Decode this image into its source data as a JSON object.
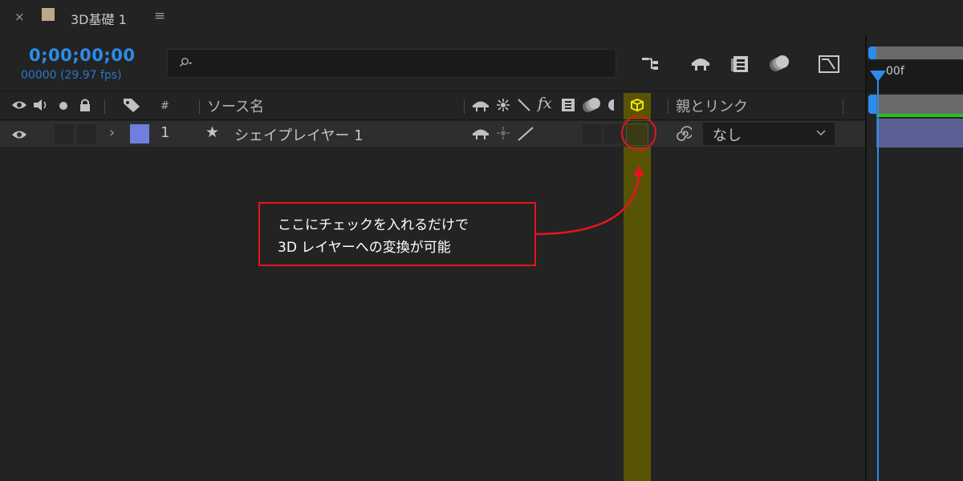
{
  "tab": {
    "close": "×",
    "title": "3D基礎 1",
    "menu": "≡"
  },
  "time": {
    "timecode": "0;00;00;00",
    "frames": "00000 (29.97 fps)"
  },
  "search": {
    "value": ""
  },
  "columns": {
    "number": "#",
    "source_name": "ソース名",
    "parent": "親とリンク",
    "fx": "fx"
  },
  "layer": {
    "number": "1",
    "name": "シェイプレイヤー 1",
    "parent": "なし"
  },
  "callout": {
    "line1": "ここにチェックを入れるだけで",
    "line2": "3D レイヤーへの変換が可能"
  },
  "timeline": {
    "frame_label": "00f"
  },
  "colors": {
    "timecode": "#2d8ceb",
    "label_swatch": "#6f7fe0",
    "highlight_column": "#605e00",
    "callout_border": "#e8141c",
    "timeline_bar": "#5a5f94",
    "work_area_green": "#22c222"
  },
  "icons": {
    "header": [
      "eye-icon",
      "speaker-icon",
      "solo-dot-icon",
      "lock-icon",
      "label-tag-icon"
    ],
    "switches": [
      "shy-icon",
      "collapse-icon",
      "quality-icon",
      "effect-icon",
      "frame-blend-icon",
      "motion-blur-icon",
      "adjustment-icon",
      "cube-3d-icon"
    ],
    "tools": [
      "flowchart-icon",
      "shy-master-icon",
      "frame-blending-master-icon",
      "motion-blur-master-icon",
      "graph-editor-icon"
    ]
  }
}
